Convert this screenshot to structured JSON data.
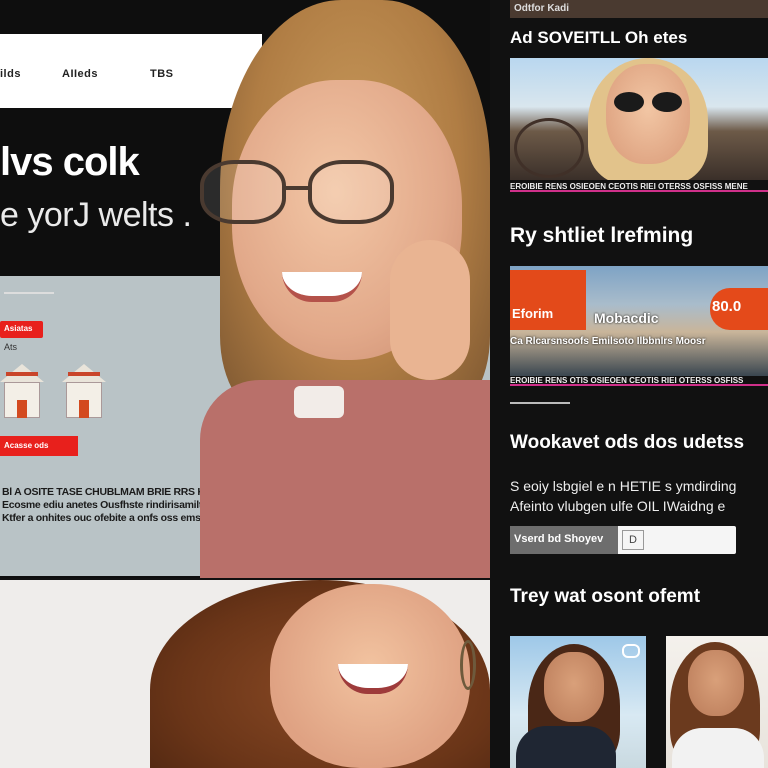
{
  "hero": {
    "nav": [
      "ilds",
      "AIIeds",
      "TBS"
    ],
    "headline": "lvs colk",
    "subheadline": "e yorJ welts .",
    "tag_button": "Asiatas",
    "mini_text": "Ats",
    "cta_button": "Acasse ods",
    "paragraph": [
      "Bl A OSITE TASE CHUBLMAM BRIE RRS KOMIME MUDRITSO DASSE ORCOIGK",
      "Ecosme ediu anetes Ousfhste rindirisamilt Rlowsst a obocte sifinesiil",
      "Ktfer a onhites ouc ofebite a onfs oss emsefes"
    ]
  },
  "sidebar": {
    "topbar": "Odtfor Kadi",
    "section1_title": "Ad SOVEITLL Oh etes",
    "caption1": "EROIBIE RENS OSIEOEN CEOTIS RIEI OTERSS OSFISS MENE",
    "section2_title": "Ry shtliet lrefming",
    "badge_left": "Eforim",
    "badge_text": "Mobacdic",
    "badge_price": "80.0",
    "img2_row": "Ca Rlcarsnsoofs Emilsoto Ilbbnlrs Moosr",
    "caption2": "EROIBIE RENS OTIS OSIEOEN CEOTIS RIEI OTERSS OSFISS",
    "section3_title": "Wookavet ods dos udetss",
    "para_line1": "S eoiy lsbgiel e n HETIE s ymdirding",
    "para_line2": "Afeinto vlubgen ulfe OIL IWaidng e",
    "input_button": "Vserd bd Shoyev",
    "input_icon": "D",
    "section4_title": "Trey wat osont ofemt"
  },
  "colors": {
    "accent_red": "#e8201c",
    "accent_orange": "#e34a1a",
    "caption_pink": "#d0308a",
    "dark_bg": "#111111"
  }
}
